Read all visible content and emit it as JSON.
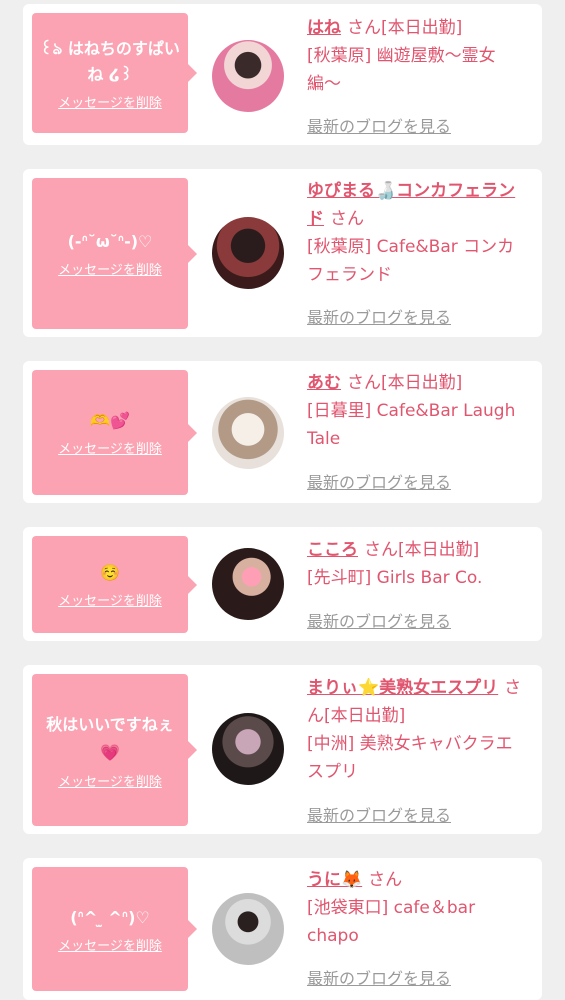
{
  "items": [
    {
      "message": "꒰ঌ はねちのすぱいね ໒꒱",
      "delete_label": "メッセージを削除",
      "name": "はね",
      "suffix": "さん",
      "status": "[本日出勤]",
      "shop": "[秋葉原] 幽遊屋敷〜霊女編〜",
      "blog_label": "最新のブログを見る"
    },
    {
      "message": "(-ᐢ˘ω˘ᐢ-)♡",
      "delete_label": "メッセージを削除",
      "name": "ゆぴまる🍶コンカフェランド",
      "suffix": "さん",
      "status": "",
      "shop": "[秋葉原] Cafe&Bar コンカフェランド",
      "blog_label": "最新のブログを見る"
    },
    {
      "message": "🫶💕",
      "delete_label": "メッセージを削除",
      "name": "あむ",
      "suffix": "さん",
      "status": "[本日出勤]",
      "shop": "[日暮里] Cafe&Bar Laugh Tale",
      "blog_label": "最新のブログを見る"
    },
    {
      "message": "☺️",
      "delete_label": "メッセージを削除",
      "name": "こころ",
      "suffix": "さん",
      "status": "[本日出勤]",
      "shop": "[先斗町] Girls Bar Co.",
      "blog_label": "最新のブログを見る"
    },
    {
      "message": "秋はいいですねぇ💗",
      "delete_label": "メッセージを削除",
      "name": "まりぃ⭐️美熟女エスプリ",
      "suffix": "さん",
      "status": "[本日出勤]",
      "shop": "[中洲] 美熟女キャバクラエスプリ",
      "blog_label": "最新のブログを見る"
    },
    {
      "message": "(ᐢ^ ̫ ^ᐢ)♡",
      "delete_label": "メッセージを削除",
      "name": "うに🦊",
      "suffix": "さん",
      "status": "",
      "shop": "[池袋東口] cafe＆bar chapo",
      "blog_label": "最新のブログを見る"
    }
  ],
  "colors": {
    "accent": "#e0566f",
    "bubble": "#fba3b2",
    "link_gray": "#9a9a9a",
    "background": "#efefef"
  }
}
